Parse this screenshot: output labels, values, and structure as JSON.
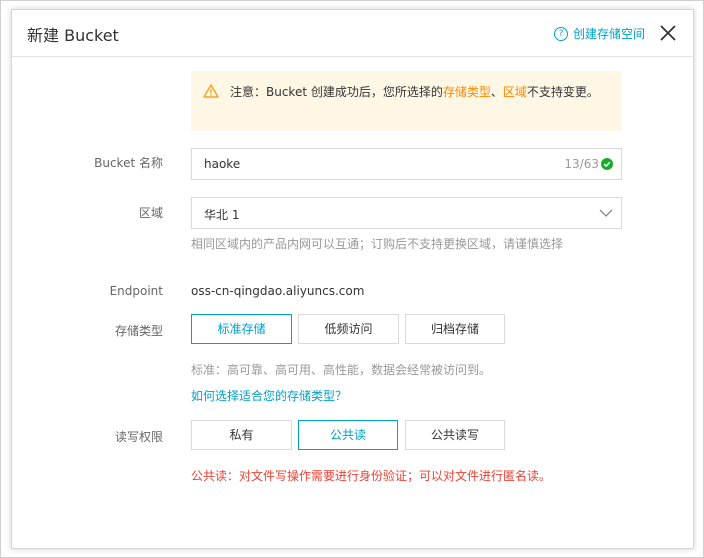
{
  "dialog": {
    "title": "新建 Bucket",
    "help_link": "创建存储空间",
    "help_icon": "?"
  },
  "notice": {
    "prefix": "注意：Bucket 创建成功后，您所选择的",
    "highlight1": "存储类型",
    "separator": "、",
    "highlight2": "区域",
    "suffix": "不支持变更。"
  },
  "bucket_name": {
    "label": "Bucket 名称",
    "value": "haoke",
    "counter": "13/63"
  },
  "region": {
    "label": "区域",
    "value": "华北 1",
    "hint": "相同区域内的产品内网可以互通；订购后不支持更换区域，请谨慎选择"
  },
  "endpoint": {
    "label": "Endpoint",
    "value": "oss-cn-qingdao.aliyuncs.com"
  },
  "storage_class": {
    "label": "存储类型",
    "options": [
      "标准存储",
      "低频访问",
      "归档存储"
    ],
    "selected": "标准存储",
    "hint": "标准：高可靠、高可用、高性能，数据会经常被访问到。",
    "help_link": "如何选择适合您的存储类型？"
  },
  "acl": {
    "label": "读写权限",
    "options": [
      "私有",
      "公共读",
      "公共读写"
    ],
    "selected": "公共读",
    "warning": "公共读：对文件写操作需要进行身份验证；可以对文件进行匿名读。"
  },
  "colors": {
    "accent": "#00a2ca",
    "warning": "#ff8a00",
    "error": "#f04134",
    "success": "#1aab2b",
    "notice_bg": "#fff7e6"
  }
}
